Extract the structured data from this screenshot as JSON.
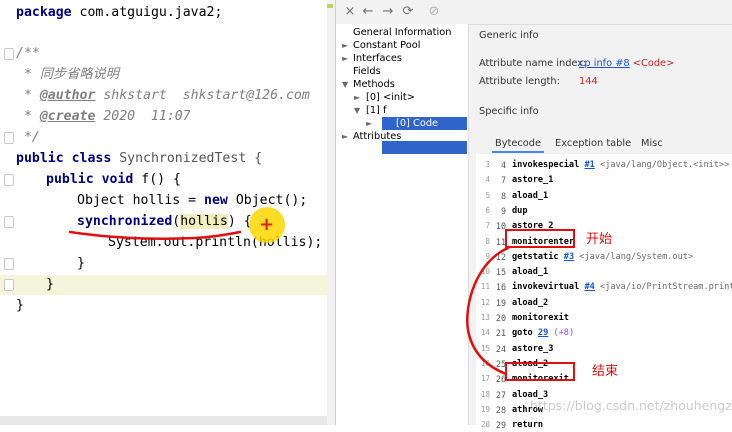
{
  "editor": {
    "code": {
      "line1": {
        "kw": "package",
        "rest": " com.atguigu.java2;"
      },
      "line2": {
        "open": "/**"
      },
      "line3": {
        "prefix": " * ",
        "text": "同步省略说明"
      },
      "line4": {
        "prefix": " * ",
        "tag": "@author",
        "text": " shkstart  shkstart@126.com"
      },
      "line5": {
        "prefix": " * ",
        "tag": "@create",
        "text": " 2020  11:07"
      },
      "line6": {
        "close": " */"
      },
      "line7": {
        "kw1": "public",
        "kw2": " class",
        "name": " SynchronizedTest {"
      },
      "line8": {
        "kw1": "public",
        "kw2": " void",
        "name": " f() {"
      },
      "line9": {
        "a": "Object hollis = ",
        "kw": "new",
        "b": " Object();"
      },
      "line10": {
        "kw": "synchronized",
        "open": "(",
        "var": "hollis",
        "close": ") {"
      },
      "line11": {
        "text": "System.out.println(hollis);"
      },
      "line12": {
        "text": "}"
      },
      "line13": {
        "text": "}"
      },
      "line14": {
        "text": "}"
      }
    },
    "cursor_mark": "+"
  },
  "toolbar": {
    "close_icon": "×",
    "back_icon": "←",
    "forward_icon": "→",
    "refresh_icon": "⟳",
    "globe_icon": "⊘"
  },
  "tree": {
    "general": "General Information",
    "constant_pool": "Constant Pool",
    "interfaces": "Interfaces",
    "fields": "Fields",
    "methods": "Methods",
    "init": "[0] <init>",
    "f": "[1] f",
    "code": "[0] Code",
    "attributes": "Attributes"
  },
  "detail": {
    "generic_info": "Generic info",
    "attr_name_label": "Attribute name index:",
    "attr_name_link": "cp info #8",
    "attr_name_value": "<Code>",
    "attr_length_label": "Attribute length:",
    "attr_length_value": "144",
    "specific_info": "Specific info",
    "tabs": [
      "Bytecode",
      "Exception table",
      "Misc"
    ]
  },
  "bytecode": [
    {
      "n": "3",
      "off": "4",
      "op": "invokespecial",
      "ref": "#1",
      "cmt": " <java/lang/Object.<init>>"
    },
    {
      "n": "4",
      "off": "7",
      "op": "astore_1"
    },
    {
      "n": "5",
      "off": "8",
      "op": "aload_1"
    },
    {
      "n": "6",
      "off": "9",
      "op": "dup"
    },
    {
      "n": "7",
      "off": "10",
      "op": "astore_2"
    },
    {
      "n": "8",
      "off": "11",
      "op": "monitorenter"
    },
    {
      "n": "9",
      "off": "12",
      "op": "getstatic",
      "ref": "#3",
      "cmt": " <java/lang/System.out>"
    },
    {
      "n": "10",
      "off": "15",
      "op": "aload_1"
    },
    {
      "n": "11",
      "off": "16",
      "op": "invokevirtual",
      "ref": "#4",
      "cmt": " <java/io/PrintStream.println>"
    },
    {
      "n": "12",
      "off": "19",
      "op": "aload_2"
    },
    {
      "n": "13",
      "off": "20",
      "op": "monitorexit"
    },
    {
      "n": "14",
      "off": "21",
      "op": "goto",
      "ref": "29",
      "cnt": " (+8)"
    },
    {
      "n": "15",
      "off": "24",
      "op": "astore_3"
    },
    {
      "n": "16",
      "off": "25",
      "op": "aload_2"
    },
    {
      "n": "17",
      "off": "26",
      "op": "monitorexit"
    },
    {
      "n": "18",
      "off": "27",
      "op": "aload_3"
    },
    {
      "n": "19",
      "off": "28",
      "op": "athrow"
    },
    {
      "n": "20",
      "off": "29",
      "op": "return"
    }
  ],
  "annotations": {
    "start": "开始",
    "end": "结束"
  },
  "watermark": "https://blog.csdn.net/zhouhengzhe",
  "colors": {
    "annotation_red": "#e01010",
    "selection_blue": "#2f65ca",
    "link_blue": "#1a55d8"
  }
}
